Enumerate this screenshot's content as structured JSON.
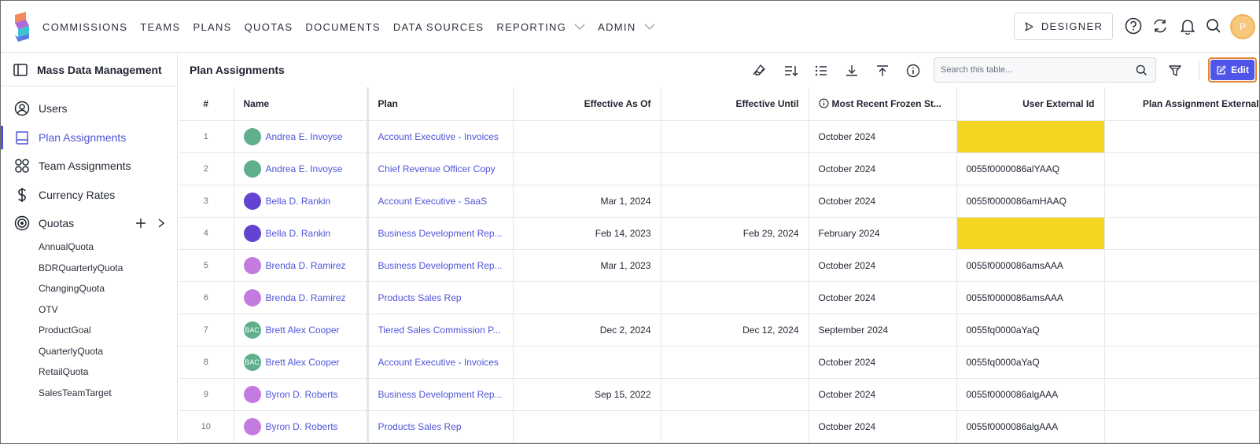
{
  "nav": {
    "items": [
      {
        "label": "COMMISSIONS",
        "dropdown": false
      },
      {
        "label": "TEAMS",
        "dropdown": false
      },
      {
        "label": "PLANS",
        "dropdown": false
      },
      {
        "label": "QUOTAS",
        "dropdown": false
      },
      {
        "label": "DOCUMENTS",
        "dropdown": false
      },
      {
        "label": "DATA SOURCES",
        "dropdown": false
      },
      {
        "label": "REPORTING",
        "dropdown": true
      },
      {
        "label": "ADMIN",
        "dropdown": true
      }
    ],
    "designer_label": "DESIGNER",
    "avatar_initial": "P"
  },
  "sidebar": {
    "title": "Mass Data Management",
    "items": [
      {
        "label": "Users",
        "icon": "user-icon"
      },
      {
        "label": "Plan Assignments",
        "icon": "book-icon",
        "active": true
      },
      {
        "label": "Team Assignments",
        "icon": "team-icon"
      },
      {
        "label": "Currency Rates",
        "icon": "dollar-icon"
      },
      {
        "label": "Quotas",
        "icon": "target-icon"
      }
    ],
    "quotas": [
      "AnnualQuota",
      "BDRQuarterlyQuota",
      "ChangingQuota",
      "OTV",
      "ProductGoal",
      "QuarterlyQuota",
      "RetailQuota",
      "SalesTeamTarget"
    ]
  },
  "main": {
    "title": "Plan Assignments",
    "search_placeholder": "Search this table...",
    "edit_label": "Edit"
  },
  "table": {
    "columns": [
      "#",
      "Name",
      "Plan",
      "Effective As Of",
      "Effective Until",
      "Most Recent Frozen St...",
      "User External Id",
      "Plan Assignment External Id"
    ],
    "rows": [
      {
        "num": "1",
        "name": "Andrea E. Invoyse",
        "avatar_color": "#5fae8c",
        "initials": "",
        "plan": "Account Executive - Invoices",
        "as_of": "",
        "until": "",
        "frozen": "October 2024",
        "ext_id": "",
        "highlight": true
      },
      {
        "num": "2",
        "name": "Andrea E. Invoyse",
        "avatar_color": "#5fae8c",
        "initials": "",
        "plan": "Chief Revenue Officer Copy",
        "as_of": "",
        "until": "",
        "frozen": "October 2024",
        "ext_id": "0055f0000086alYAAQ",
        "highlight": false
      },
      {
        "num": "3",
        "name": "Bella D. Rankin",
        "avatar_color": "#6244d0",
        "initials": "",
        "plan": "Account Executive - SaaS",
        "as_of": "Mar 1, 2024",
        "until": "",
        "frozen": "October 2024",
        "ext_id": "0055f0000086amHAAQ",
        "highlight": false
      },
      {
        "num": "4",
        "name": "Bella D. Rankin",
        "avatar_color": "#6244d0",
        "initials": "",
        "plan": "Business Development Rep...",
        "as_of": "Feb 14, 2023",
        "until": "Feb 29, 2024",
        "frozen": "February 2024",
        "ext_id": "",
        "highlight": true
      },
      {
        "num": "5",
        "name": "Brenda D. Ramirez",
        "avatar_color": "#c47be0",
        "initials": "",
        "plan": "Business Development Rep...",
        "as_of": "Mar 1, 2023",
        "until": "",
        "frozen": "October 2024",
        "ext_id": "0055f0000086amsAAA",
        "highlight": false
      },
      {
        "num": "6",
        "name": "Brenda D. Ramirez",
        "avatar_color": "#c47be0",
        "initials": "",
        "plan": "Products Sales Rep",
        "as_of": "",
        "until": "",
        "frozen": "October 2024",
        "ext_id": "0055f0000086amsAAA",
        "highlight": false
      },
      {
        "num": "7",
        "name": "Brett Alex Cooper",
        "avatar_color": "#5fae8c",
        "initials": "BAC",
        "plan": "Tiered Sales Commission P...",
        "as_of": "Dec 2, 2024",
        "until": "Dec 12, 2024",
        "frozen": "September 2024",
        "ext_id": "0055fq0000aYaQ",
        "highlight": false
      },
      {
        "num": "8",
        "name": "Brett Alex Cooper",
        "avatar_color": "#5fae8c",
        "initials": "BAC",
        "plan": "Account Executive - Invoices",
        "as_of": "",
        "until": "",
        "frozen": "October 2024",
        "ext_id": "0055fq0000aYaQ",
        "highlight": false
      },
      {
        "num": "9",
        "name": "Byron D. Roberts",
        "avatar_color": "#c47be0",
        "initials": "",
        "plan": "Business Development Rep...",
        "as_of": "Sep 15, 2022",
        "until": "",
        "frozen": "October 2024",
        "ext_id": "0055f0000086algAAA",
        "highlight": false
      },
      {
        "num": "10",
        "name": "Byron D. Roberts",
        "avatar_color": "#c47be0",
        "initials": "",
        "plan": "Products Sales Rep",
        "as_of": "",
        "until": "",
        "frozen": "October 2024",
        "ext_id": "0055f0000086algAAA",
        "highlight": false
      }
    ]
  },
  "colors": {
    "accent": "#4f55d8",
    "highlight": "#f2d621",
    "edit_outline": "#e8862c"
  }
}
